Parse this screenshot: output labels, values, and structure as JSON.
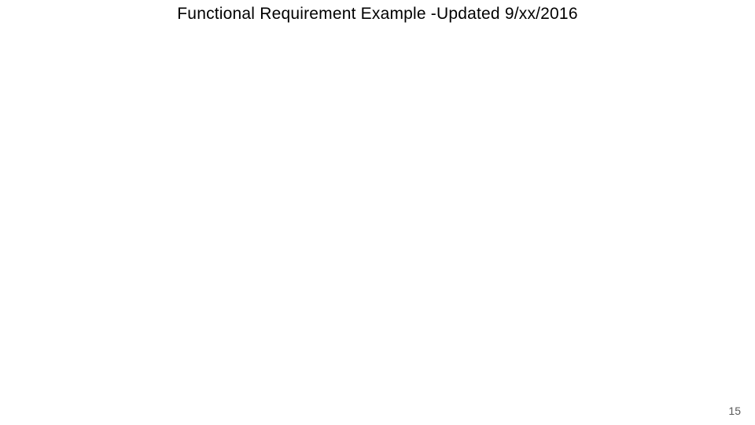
{
  "slide": {
    "title": "Functional Requirement Example -Updated 9/xx/2016",
    "page_number": "15"
  }
}
